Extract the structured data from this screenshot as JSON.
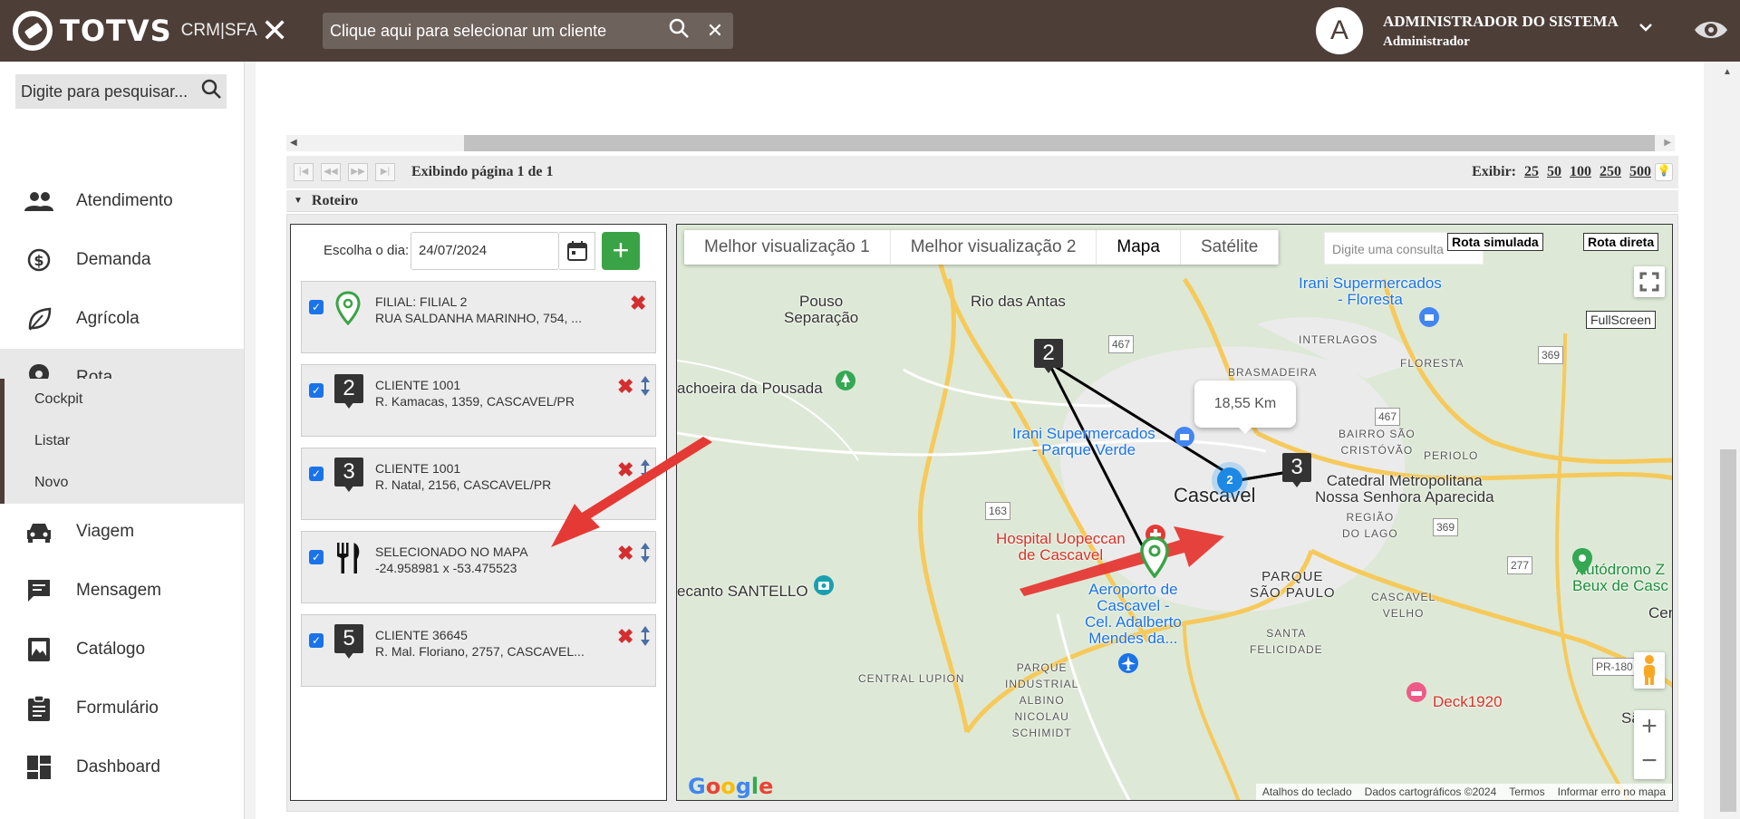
{
  "header": {
    "brand": "TOTVS",
    "product": "CRM|SFA",
    "client_placeholder": "Clique aqui para selecionar um cliente",
    "user_initial": "A",
    "user_name": "ADMINISTRADOR DO SISTEMA",
    "user_role": "Administrador"
  },
  "sidebar": {
    "search_placeholder": "Digite para pesquisar...",
    "items": [
      {
        "label": "Atendimento",
        "icon": "people-icon"
      },
      {
        "label": "Demanda",
        "icon": "dollar-cycle-icon"
      },
      {
        "label": "Agrícola",
        "icon": "leaf-icon"
      },
      {
        "label": "Rota",
        "icon": "location-pin-icon"
      },
      {
        "label": "Viagem",
        "icon": "car-icon"
      },
      {
        "label": "Mensagem",
        "icon": "chat-icon"
      },
      {
        "label": "Catálogo",
        "icon": "image-book-icon"
      },
      {
        "label": "Formulário",
        "icon": "clipboard-icon"
      },
      {
        "label": "Dashboard",
        "icon": "dashboard-icon"
      }
    ],
    "sub_items": [
      {
        "label": "Cockpit"
      },
      {
        "label": "Listar"
      },
      {
        "label": "Novo"
      }
    ]
  },
  "pager": {
    "text": "Exibindo página 1 de 1",
    "show_label": "Exibir:",
    "options": [
      "25",
      "50",
      "100",
      "250",
      "500"
    ]
  },
  "roteiro": {
    "title": "Roteiro",
    "day_label": "Escolha o dia:",
    "day_value": "24/07/2024",
    "stops": [
      {
        "marker": "pin",
        "title": "FILIAL: FILIAL 2",
        "address": "RUA SALDANHA MARINHO, 754, ..."
      },
      {
        "marker": "2",
        "title": "CLIENTE 1001",
        "address": "R. Kamacas, 1359, CASCAVEL/PR"
      },
      {
        "marker": "3",
        "title": "CLIENTE 1001",
        "address": "R. Natal, 2156, CASCAVEL/PR"
      },
      {
        "marker": "fork-knife",
        "title": "SELECIONADO NO MAPA",
        "address": "-24.958981 x -53.475523"
      },
      {
        "marker": "5",
        "title": "CLIENTE 36645",
        "address": "R. Mal. Floriano, 2757, CASCAVEL..."
      }
    ]
  },
  "map": {
    "tabs": [
      "Melhor visualização 1",
      "Melhor visualização 2",
      "Mapa",
      "Satélite"
    ],
    "selected_tab": "Mapa",
    "query_placeholder": "Digite uma consulta",
    "btn_simulated": "Rota simulada",
    "btn_direct": "Rota direta",
    "fullscreen_label": "FullScreen",
    "distance": "18,55 Km",
    "cluster_count": "2",
    "marker_2": "2",
    "marker_3": "3",
    "zoom_in": "+",
    "zoom_out": "−",
    "labels": {
      "pouso": "Pouso\nSeparação",
      "rio_antas": "Rio das Antas",
      "irani_floresta": "Irani Supermercados\n- Floresta",
      "interlagos": "INTERLAGOS",
      "floresta": "FLORESTA",
      "brasmadeira": "BRASMADEIRA",
      "cachoeira": "achoeira da Pousada",
      "irani_parque": "Irani Supermercados\n- Parque Verde",
      "bairro_sao": "BAIRRO SÃO\nCRISTÓVÃO",
      "periolo": "PERIOLO",
      "catedral": "Catedral Metropolitana\nNossa Senhora Aparecida",
      "cascavel": "Cascavel",
      "regiao": "REGIÃO\nDO LAGO",
      "hospital": "Hospital Uopeccan\nde Cascavel",
      "aeroporto": "Aeroporto de\nCascavel -\nCel. Adalberto\nMendes da...",
      "parque_sp": "PARQUE\nSÃO PAULO",
      "cascavel_velho": "CASCAVEL\nVELHO",
      "autodromo": "Autódromo Z\nBeux de Casc",
      "cen": "Cen",
      "santello": "ecanto SANTELLO",
      "santa_felicidade": "SANTA\nFELICIDADE",
      "central_lupion": "CENTRAL LUPION",
      "parque_industrial": "PARQUE\nINDUSTRIAL\nALBINO\nNICOLAU\nSCHIMIDT",
      "deck": "Deck1920",
      "sao_d": "São D",
      "r467a": "467",
      "r467b": "467",
      "r369a": "369",
      "r369b": "369",
      "r163": "163",
      "r277": "277",
      "pr180": "PR-180"
    },
    "google": "Google",
    "attribution": [
      "Atalhos do teclado",
      "Dados cartográficos ©2024",
      "Termos",
      "Informar erro no mapa"
    ]
  }
}
